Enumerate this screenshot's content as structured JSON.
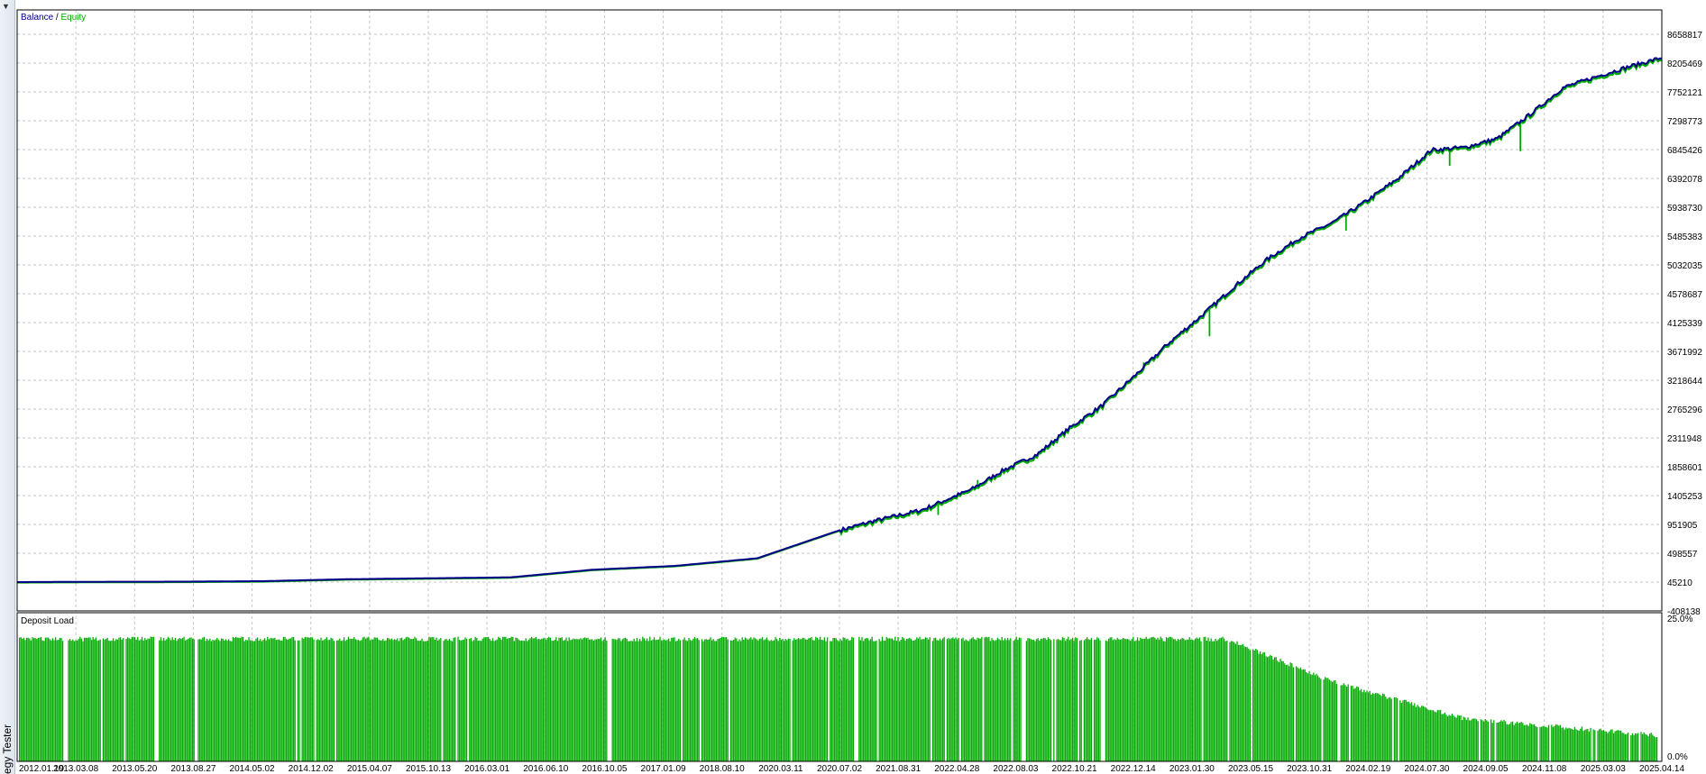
{
  "panel": {
    "side_label": "egy Tester",
    "arrow_glyph": "▼"
  },
  "legend": {
    "balance": "Balance",
    "separator": " / ",
    "equity": "Equity",
    "deposit_load": "Deposit Load"
  },
  "colors": {
    "balance": "#00008b",
    "equity": "#00aa00",
    "deposit": "#00aa00",
    "grid": "#c6c6c6",
    "frame": "#000000"
  },
  "chart_data": [
    {
      "type": "line",
      "series": [
        {
          "name": "Balance",
          "x": [
            0,
            5,
            10,
            15,
            20,
            25,
            30,
            35,
            40,
            45,
            50,
            52,
            55,
            58,
            60,
            62,
            64,
            66,
            68,
            70,
            72,
            74,
            76,
            78,
            80,
            82,
            84,
            86,
            88,
            90,
            92,
            94,
            96,
            98,
            100
          ],
          "y": [
            45210,
            50000,
            52000,
            60000,
            90000,
            105000,
            120000,
            240000,
            300000,
            420000,
            860000,
            1000000,
            1180000,
            1500000,
            1810000,
            2050000,
            2470000,
            2830000,
            3300000,
            3800000,
            4230000,
            4690000,
            5120000,
            5460000,
            5700000,
            6030000,
            6400000,
            6840000,
            6880000,
            7020000,
            7400000,
            7820000,
            7990000,
            8150000,
            8290000
          ]
        },
        {
          "name": "Equity",
          "spikes": [
            {
              "x": 56,
              "y": 1100000
            },
            {
              "x": 58.4,
              "y": 1650000
            },
            {
              "x": 68.5,
              "y": 3500000
            },
            {
              "x": 72.5,
              "y": 3910000
            },
            {
              "x": 80.8,
              "y": 5570000
            },
            {
              "x": 87.1,
              "y": 6590000
            },
            {
              "x": 91.4,
              "y": 6820000
            }
          ]
        }
      ],
      "x_ticks": [
        "2012.01.19",
        "2013.03.08",
        "2013.05.20",
        "2013.08.27",
        "2014.05.02",
        "2014.12.02",
        "2015.04.07",
        "2015.10.13",
        "2016.03.01",
        "2016.06.10",
        "2016.10.05",
        "2017.01.09",
        "2018.08.10",
        "2020.03.11",
        "2020.07.02",
        "2021.08.31",
        "2022.04.28",
        "2022.08.03",
        "2022.10.21",
        "2022.12.14",
        "2023.01.30",
        "2023.05.15",
        "2023.10.31",
        "2024.02.19",
        "2024.07.30",
        "2024.09.05",
        "2024.11.08",
        "2025.03.03",
        "2025.04.14"
      ],
      "y_ticks": [
        "8658817",
        "8205469",
        "7752121",
        "7298773",
        "6845426",
        "6392078",
        "5938730",
        "5485383",
        "5032035",
        "4578687",
        "4125339",
        "3671992",
        "3218644",
        "2765296",
        "2311948",
        "1858601",
        "1405253",
        "951905",
        "498557",
        "45210",
        "-408138"
      ],
      "ylim": [
        -408138,
        8658817
      ],
      "grid": true,
      "legend": "top-left"
    },
    {
      "type": "bar",
      "title": "Deposit Load",
      "y_ticks": [
        "25.0%",
        "0.0%"
      ],
      "ylim": [
        0,
        25
      ],
      "phases": [
        {
          "x_start": 0,
          "x_end": 73.5,
          "level": 21.5
        },
        {
          "x_start": 73.5,
          "x_end": 80,
          "level": 14
        },
        {
          "x_start": 80,
          "x_end": 88,
          "level": 7.5
        },
        {
          "x_start": 88,
          "x_end": 100,
          "level": 4.5
        }
      ],
      "gaps": [
        3,
        8.5,
        36,
        51,
        61.2,
        66
      ]
    }
  ]
}
